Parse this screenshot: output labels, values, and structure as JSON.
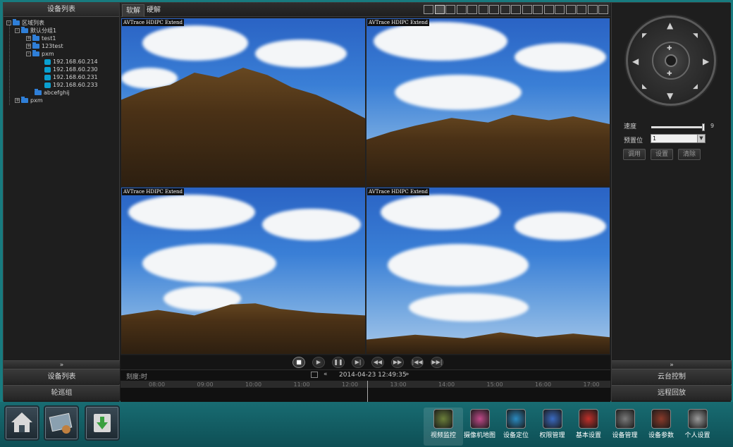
{
  "left_panel": {
    "title": "设备列表",
    "collapse_glyph": "»",
    "buttons": [
      "设备列表",
      "轮巡组"
    ],
    "tree": {
      "root": "区域列表",
      "groups": [
        {
          "label": "默认分组1",
          "children": [
            {
              "label": "test1",
              "type": "folder",
              "expander": "+"
            },
            {
              "label": "123test",
              "type": "folder",
              "expander": "+"
            },
            {
              "label": "pxm",
              "type": "folder",
              "expander": "-",
              "children": [
                {
                  "label": "192.168.60.214",
                  "type": "camera"
                },
                {
                  "label": "192.168.60.230",
                  "type": "camera"
                },
                {
                  "label": "192.168.60.231",
                  "type": "camera"
                },
                {
                  "label": "192.168.60.233",
                  "type": "camera"
                }
              ]
            },
            {
              "label": "abcefghij",
              "type": "folder"
            }
          ]
        },
        {
          "label": "pxm",
          "children": []
        }
      ]
    }
  },
  "center": {
    "tabs": [
      "软解",
      "硬解"
    ],
    "active_tab": 0,
    "layout_icon_count": 17,
    "selected_layout_index": 1,
    "tiles": [
      {
        "label": "AVTrace HDIPC Extend"
      },
      {
        "label": "AVTrace HDIPC Extend"
      },
      {
        "label": "AVTrace HDIPC Extend"
      },
      {
        "label": "AVTrace HDIPC Extend"
      }
    ],
    "playback_controls": [
      {
        "name": "stop",
        "glyph": "■"
      },
      {
        "name": "play",
        "glyph": "▶"
      },
      {
        "name": "pause",
        "glyph": "❚❚"
      },
      {
        "name": "step",
        "glyph": "▶|"
      },
      {
        "name": "slow",
        "glyph": "◀◀"
      },
      {
        "name": "fast",
        "glyph": "▶▶"
      },
      {
        "name": "prev",
        "glyph": "|◀◀"
      },
      {
        "name": "next",
        "glyph": "▶▶|"
      }
    ],
    "timeline": {
      "scale_label": "刻度:时",
      "date": "2014-04-23 12:49:35",
      "hours": [
        "08:00",
        "09:00",
        "10:00",
        "11:00",
        "12:00",
        "13:00",
        "14:00",
        "15:00",
        "16:00",
        "17:00"
      ]
    }
  },
  "right_panel": {
    "speed_label": "速度",
    "speed_value": "9",
    "speed_fraction": 0.98,
    "preset_label": "预置位",
    "preset_value": "1",
    "buttons": [
      "调用",
      "设置",
      "清除"
    ],
    "collapse_glyph": "»",
    "bottom_buttons": [
      "云台控制",
      "远程回放"
    ]
  },
  "bottom_nav": [
    {
      "label": "视频监控",
      "icon": "video-grid-icon",
      "color": "#6b7f3a"
    },
    {
      "label": "摄像机地图",
      "icon": "camera-map-icon",
      "color": "#c04a8a"
    },
    {
      "label": "设备定位",
      "icon": "globe-icon",
      "color": "#2a8ac0"
    },
    {
      "label": "权限管理",
      "icon": "users-icon",
      "color": "#3a6ac0"
    },
    {
      "label": "基本设置",
      "icon": "settings-wheel-icon",
      "color": "#c0302a"
    },
    {
      "label": "设备管理",
      "icon": "tools-icon",
      "color": "#7a7a7a"
    },
    {
      "label": "设备参数",
      "icon": "chip-icon",
      "color": "#8a3a2a"
    },
    {
      "label": "个人设置",
      "icon": "gear-icon",
      "color": "#9a9a9a"
    }
  ],
  "active_nav_index": 0
}
